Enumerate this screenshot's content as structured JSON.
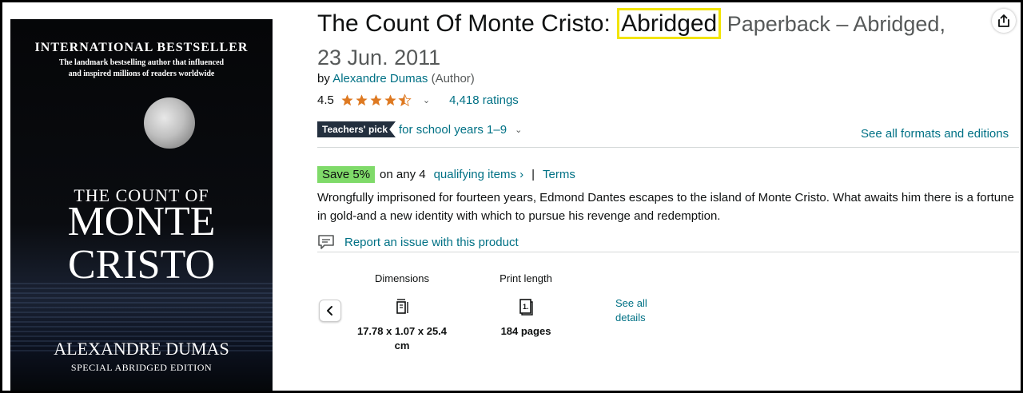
{
  "cover": {
    "top_line": "INTERNATIONAL BESTSELLER",
    "sub_line1": "The landmark bestselling author that influenced",
    "sub_line2": "and inspired millions of readers worldwide",
    "title_line1": "THE COUNT OF",
    "title_line2": "MONTE",
    "title_line3": "CRISTO",
    "author": "ALEXANDRE DUMAS",
    "edition": "SPECIAL ABRIDGED EDITION"
  },
  "product": {
    "title": "The Count Of Monte Cristo: ",
    "title_highlight": "Abridged",
    "format": " Paperback – Abridged, 23 Jun. 2011",
    "by": "by ",
    "author": "Alexandre Dumas",
    "author_role": " (Author)",
    "rating": "4.5",
    "ratings_count": "4,418 ratings",
    "badge": "Teachers' pick",
    "badge_text": "for school years 1–9",
    "formats_link": "See all formats and editions"
  },
  "offer": {
    "save_badge": "Save 5%",
    "on_any": "on any 4",
    "qualifying": "qualifying items ›",
    "sep": "|",
    "terms": "Terms"
  },
  "description": "Wrongfully imprisoned for fourteen years, Edmond Dantes escapes to the island of Monte Cristo. What awaits him there is a fortune in gold-and a new identity with which to pursue his revenge and redemption.",
  "report_link": "Report an issue with this product",
  "attributes": [
    {
      "label": "Dimensions",
      "icon": "dimensions-icon",
      "value": "17.78 x 1.07 x 25.4 cm"
    },
    {
      "label": "Print length",
      "icon": "book-pages-icon",
      "value": "184 pages"
    }
  ],
  "see_all_details": "See all details",
  "colors": {
    "link": "#007185",
    "highlight": "#f2e400",
    "save_badge": "#7fda69",
    "star": "#de7921"
  }
}
